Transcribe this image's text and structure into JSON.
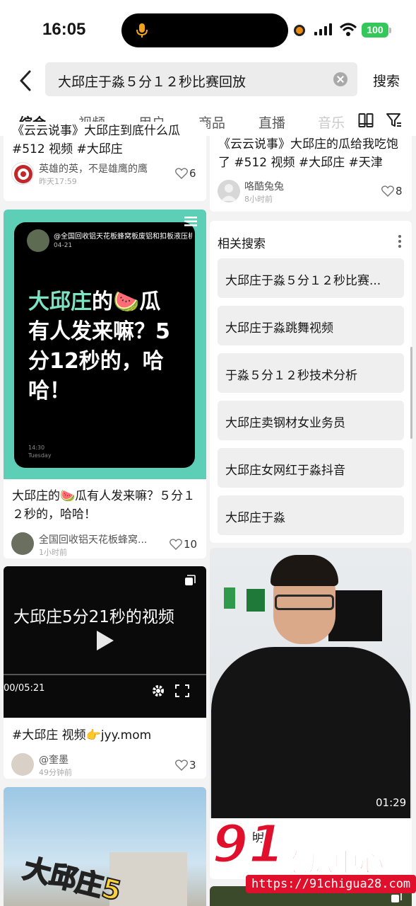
{
  "status_bar": {
    "time": "16:05",
    "battery": "100"
  },
  "search": {
    "query": "大邱庄于淼５分１２秒比赛回放",
    "submit_label": "搜索"
  },
  "tabs": [
    {
      "label": "综合"
    },
    {
      "label": "视频"
    },
    {
      "label": "用户"
    },
    {
      "label": "商品"
    },
    {
      "label": "直播"
    },
    {
      "label": "音乐"
    }
  ],
  "left_column": {
    "top_card": {
      "title": "《云云说事》大邱庄到底什么瓜 #512 视频 #大邱庄",
      "author": "英雄的英，不是雄鹰的鹰",
      "time": "昨天17:59",
      "likes": "6"
    },
    "card_watermelon": {
      "thumb_account": "@全国回收铝天花板蜂窝板废铝和扣板液压机",
      "thumb_date": "04-21",
      "thumb_line1_highlight": "大邱庄",
      "thumb_line1_rest": "的🍉瓜",
      "thumb_line2": "有人发来嘛？5",
      "thumb_line3": "分12秒的，哈",
      "thumb_line4": "哈！",
      "thumb_clock": "14:30",
      "thumb_day": "Tuesday",
      "title": "大邱庄的🍉瓜有人发来嘛？５分１２秒的，哈哈！",
      "author": "全国回收铝天花板蜂窝...",
      "time": "1小时前",
      "likes": "10"
    },
    "card_video": {
      "thumb_title": "大邱庄5分21秒的视频",
      "thumb_timecode": "00/05:21",
      "title": "#大邱庄 视频👉jyy.mom",
      "author": "@奎墨",
      "time": "49分钟前",
      "likes": "3"
    },
    "card_bottom": {
      "thumb_text": "大邱庄5"
    }
  },
  "right_column": {
    "top_card": {
      "title": "《云云说事》大邱庄的瓜给我吃饱了 #512 视频 #大邱庄 #天津",
      "author": "咯酷兔兔",
      "time": "8小时前",
      "likes": "8"
    },
    "related": {
      "heading": "相关搜索",
      "items": [
        "大邱庄于淼５分１２秒比赛...",
        "大邱庄于淼跳舞视频",
        "于淼５分１２秒技术分析",
        "大邱庄卖钢材女业务员",
        "大邱庄女网红于淼抖音",
        "大邱庄于淼"
      ]
    },
    "video_card": {
      "duration": "01:29",
      "author_partial": "明"
    }
  },
  "watermark": {
    "number": "91",
    "text": "吃瓜中心",
    "url": "https://91chigua28.com"
  },
  "colors": {
    "accent_green": "#7de3c2",
    "thumb_teal": "#5ecfb7",
    "watermark_red": "#e0102c",
    "battery_green": "#34c759"
  }
}
